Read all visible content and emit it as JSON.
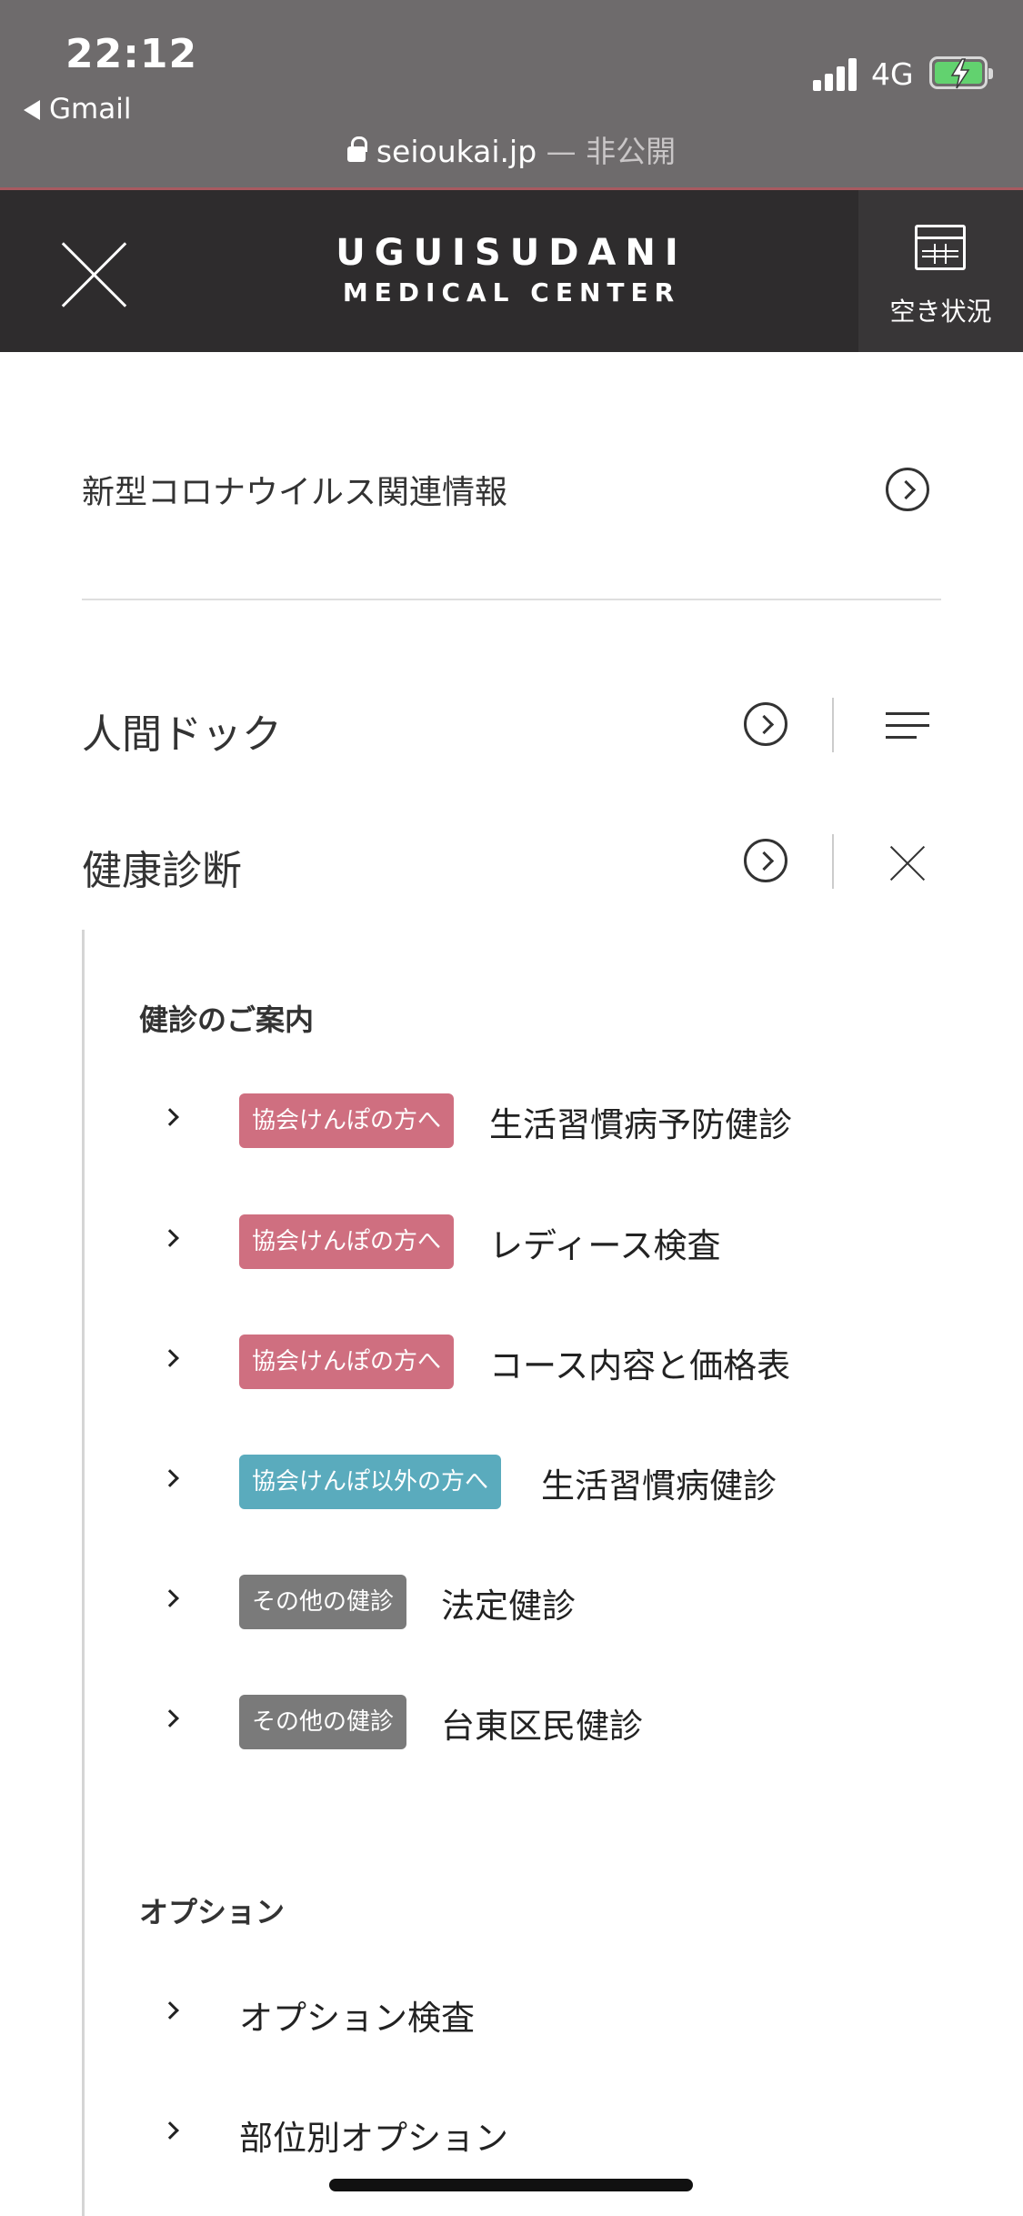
{
  "status": {
    "time": "22:12",
    "back_app": "Gmail",
    "network": "4G"
  },
  "url": {
    "domain": "seioukai.jp",
    "suffix": "— 非公開"
  },
  "header": {
    "logo_line1": "UGUISUDANI",
    "logo_line2": "MEDICAL CENTER",
    "availability_label": "空き状況"
  },
  "menu": {
    "covid": "新型コロナウイルス関連情報",
    "dock": "人間ドック",
    "checkup": "健康診断"
  },
  "checkup_sections": {
    "guide_title": "健診のご案内",
    "items": [
      {
        "badge": "協会けんぽの方へ",
        "badge_color": "#cf6f80",
        "label": "生活習慣病予防健診"
      },
      {
        "badge": "協会けんぽの方へ",
        "badge_color": "#cf6f80",
        "label": "レディース検査"
      },
      {
        "badge": "協会けんぽの方へ",
        "badge_color": "#cf6f80",
        "label": "コース内容と価格表"
      },
      {
        "badge": "協会けんぽ以外の方へ",
        "badge_color": "#5aabbd",
        "label": "生活習慣病健診"
      },
      {
        "badge": "その他の健診",
        "badge_color": "#7a7a7a",
        "label": "法定健診"
      },
      {
        "badge": "その他の健診",
        "badge_color": "#7a7a7a",
        "label": "台東区民健診"
      }
    ],
    "option_title": "オプション",
    "options": [
      {
        "label": "オプション検査"
      },
      {
        "label": "部位別オプション"
      }
    ]
  }
}
